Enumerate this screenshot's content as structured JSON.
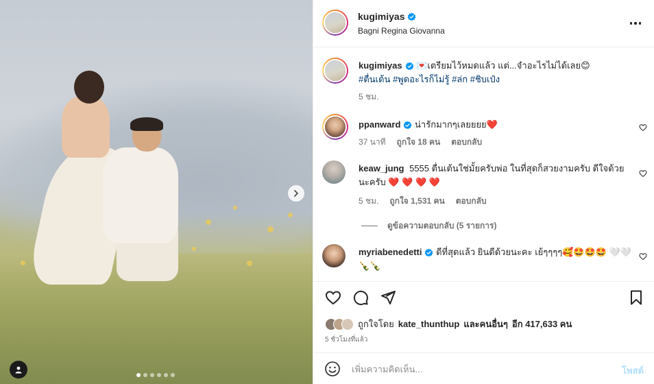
{
  "media": {
    "carousel": {
      "total": 6,
      "active": 0
    }
  },
  "header": {
    "username": "kugimiyas",
    "location": "Bagni Regina Giovanna"
  },
  "comments": [
    {
      "username": "kugimiyas",
      "text_before": "💌เตรียมไว้หมดแล้ว แต่...จำอะไรไม่ได้เลย😊",
      "tags": "#ตื่นเต้น #พูดอะไรก็ไม่รู้ #ล่ก #ชิบเป๋ง",
      "time": "5 ชม."
    },
    {
      "username": "ppanward",
      "text": "น่ารักมากๆเลยยยย❤️",
      "time": "37 นาที",
      "likes": "ถูกใจ 18 คน",
      "reply": "ตอบกลับ"
    },
    {
      "username": "keaw_jung",
      "text": "5555 ตื่นเต้นใช่มั้ยครับพ่อ ในที่สุดก็สวยงามครับ ดีใจด้วยนะครับ ❤️ ❤️ ❤️ ❤️",
      "time": "5 ชม.",
      "likes": "ถูกใจ 1,531 คน",
      "reply": "ตอบกลับ",
      "view_replies": "ดูข้อความตอบกลับ (5 รายการ)"
    },
    {
      "username": "myriabenedetti",
      "text": "ดีที่สุดแล้ว ยินดีด้วยนะคะ เย้ๆๆๆๆ🥰🤩🤩🤩 🤍🤍🍾🍾"
    }
  ],
  "likes": {
    "prefix": "ถูกใจโดย",
    "first_liker": "kate_thunthup",
    "and_others": "และคนอื่นๆ",
    "count_text": "อีก 417,633 คน"
  },
  "time_ago": "5 ชั่วโมงที่แล้ว",
  "add_comment": {
    "placeholder": "เพิ่มความคิดเห็น...",
    "post_label": "โพสต์"
  },
  "colors": {
    "verified": "#0095f6",
    "heart": "#e0245e",
    "link": "#00376b",
    "post_disabled": "#b2dffc"
  }
}
